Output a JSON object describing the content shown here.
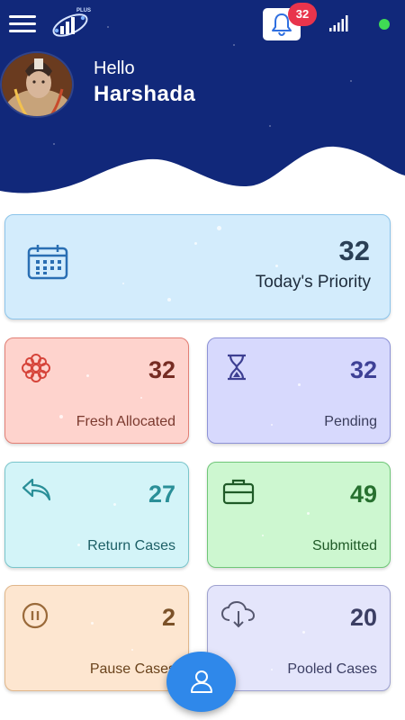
{
  "header": {
    "logo_text": "PLUS",
    "notifications": {
      "count": "32"
    },
    "greeting": "Hello",
    "user_name": "Harshada"
  },
  "colors": {
    "header_bg": "#11287a",
    "online_status": "#3fdc54",
    "badge": "#e8344c",
    "fab": "#2f88ea"
  },
  "cards": {
    "priority": {
      "count": "32",
      "label": "Today's Priority",
      "icon": "calendar-icon"
    },
    "fresh": {
      "count": "32",
      "label": "Fresh Allocated",
      "icon": "flower-icon"
    },
    "pending": {
      "count": "32",
      "label": "Pending",
      "icon": "hourglass-icon"
    },
    "return": {
      "count": "27",
      "label": "Return Cases",
      "icon": "reply-arrow-icon"
    },
    "submitted": {
      "count": "49",
      "label": "Submitted",
      "icon": "briefcase-icon"
    },
    "pause": {
      "count": "2",
      "label": "Pause Cases",
      "icon": "pause-circle-icon"
    },
    "pooled": {
      "count": "20",
      "label": "Pooled Cases",
      "icon": "cloud-download-icon"
    }
  },
  "fab": {
    "icon": "user-icon"
  }
}
